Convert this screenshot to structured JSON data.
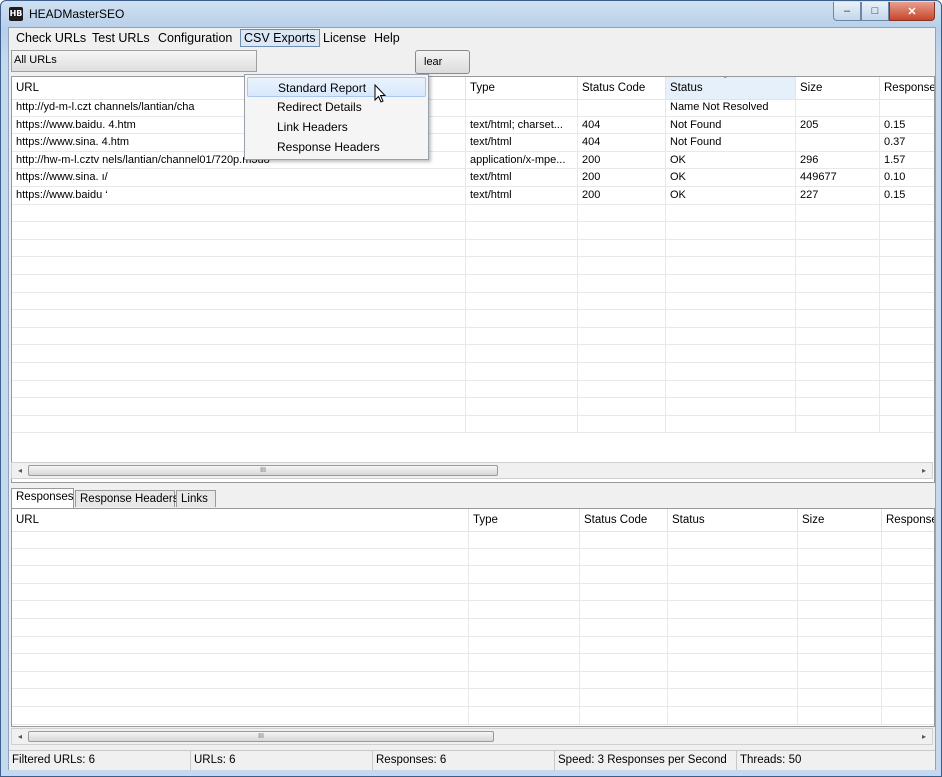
{
  "window": {
    "title": "HEADMasterSEO",
    "icon_text": "HB",
    "minimize": "–",
    "maximize": "□",
    "close": "✕"
  },
  "menubar": [
    {
      "label": "Check URLs"
    },
    {
      "label": "Test URLs"
    },
    {
      "label": "Configuration"
    },
    {
      "label": "CSV Exports"
    },
    {
      "label": "License"
    },
    {
      "label": "Help"
    }
  ],
  "filter": {
    "selected": "All URLs",
    "clear_label": "lear"
  },
  "csv_menu": [
    "Standard Report",
    "Redirect Details",
    "Link Headers",
    "Response Headers"
  ],
  "top_grid": {
    "columns": [
      "URL",
      "Type",
      "Status Code",
      "Status",
      "Size",
      "Response T"
    ],
    "sort_indicator": "ˆ",
    "rows": [
      {
        "url": "http://yd-m-l.czt                channels/lantian/cha",
        "type": "",
        "code": "",
        "status": "Name Not Resolved",
        "size": "",
        "response": ""
      },
      {
        "url": "https://www.baidu.              4.htm",
        "type": "text/html; charset...",
        "code": "404",
        "status": "Not Found",
        "size": "205",
        "response": "0.15"
      },
      {
        "url": "https://www.sina.              4.htm",
        "type": "text/html",
        "code": "404",
        "status": "Not Found",
        "size": "",
        "response": "0.37"
      },
      {
        "url": "http://hw-m-l.cztv              nels/lantian/channel01/720p.m3u8",
        "type": "application/x-mpe...",
        "code": "200",
        "status": "OK",
        "size": "296",
        "response": "1.57"
      },
      {
        "url": "https://www.sina.         ı/",
        "type": "text/html",
        "code": "200",
        "status": "OK",
        "size": "449677",
        "response": "0.10"
      },
      {
        "url": "https://www.baidu         ‘",
        "type": "text/html",
        "code": "200",
        "status": "OK",
        "size": "227",
        "response": "0.15"
      }
    ]
  },
  "tabs": [
    "Responses",
    "Response Headers",
    "Links"
  ],
  "bottom_grid": {
    "columns": [
      "URL",
      "Type",
      "Status Code",
      "Status",
      "Size",
      "Response"
    ]
  },
  "scroll": {
    "left": "◂",
    "right": "▸",
    "grip": "III"
  },
  "statusbar": {
    "filtered": "Filtered URLs: 6",
    "urls": "URLs: 6",
    "responses": "Responses: 6",
    "speed": "Speed: 3 Responses per Second",
    "threads": "Threads: 50"
  }
}
